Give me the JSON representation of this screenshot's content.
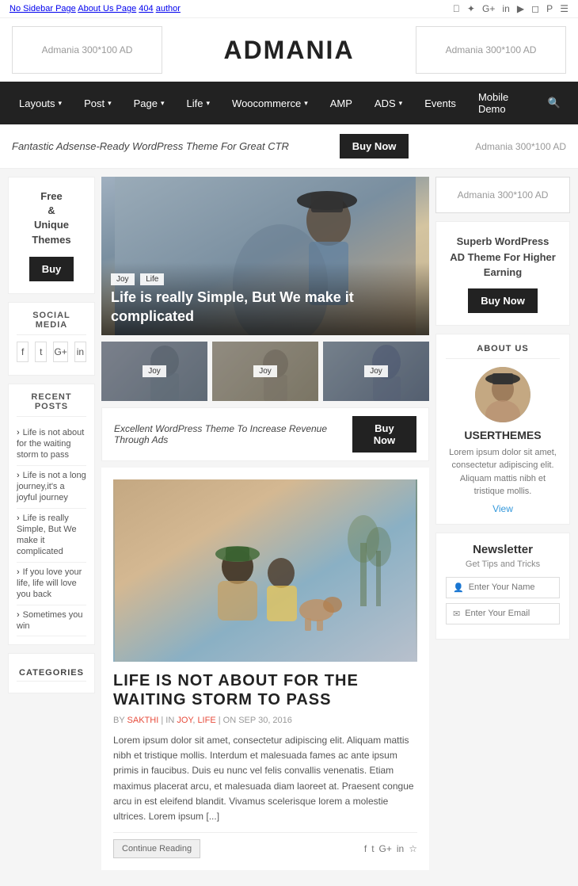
{
  "topbar": {
    "links": [
      "No Sidebar Page",
      "About Us Page",
      "404",
      "author"
    ],
    "social": [
      "f",
      "t",
      "G+",
      "in",
      "yt",
      "ig",
      "p",
      "rss"
    ]
  },
  "header": {
    "ad_left": "Admania 300*100 AD",
    "logo": "ADMANIA",
    "ad_right": "Admania 300*100 AD"
  },
  "nav": {
    "items": [
      {
        "label": "Layouts",
        "has_dropdown": true
      },
      {
        "label": "Post",
        "has_dropdown": true
      },
      {
        "label": "Page",
        "has_dropdown": true
      },
      {
        "label": "Life",
        "has_dropdown": true
      },
      {
        "label": "Woocommerce",
        "has_dropdown": true
      },
      {
        "label": "AMP",
        "has_dropdown": false
      },
      {
        "label": "ADS",
        "has_dropdown": true
      },
      {
        "label": "Events",
        "has_dropdown": false
      },
      {
        "label": "Mobile Demo",
        "has_dropdown": false
      }
    ]
  },
  "top_banner": {
    "text": "Fantastic Adsense-Ready WordPress Theme For Great CTR",
    "button": "Buy Now",
    "ad_text": "Admania 300*100 AD"
  },
  "left_sidebar": {
    "free_themes": {
      "text": "Free\n&\nUnique\nThemes",
      "button": "Buy"
    },
    "social_media_title": "SOCIAL MEDIA",
    "social_icons": [
      "f",
      "t",
      "G+",
      "in"
    ],
    "recent_posts_title": "RECENT POSTS",
    "recent_posts": [
      "Life is not about for the waiting storm to pass",
      "Life is not a long journey,it's a joyful journey",
      "Life is really Simple, But We make it complicated",
      "If you love your life, life will love you back",
      "Sometimes you win"
    ],
    "categories_title": "CATEGORIES"
  },
  "featured_post": {
    "tags": [
      "Joy",
      "Life"
    ],
    "title": "Life is really Simple, But We make it complicated"
  },
  "small_posts": [
    {
      "tag": "Joy"
    },
    {
      "tag": "Joy"
    },
    {
      "tag": "Joy"
    }
  ],
  "content_ad_banner": {
    "text": "Excellent WordPress Theme To Increase Revenue Through Ads",
    "button": "Buy Now"
  },
  "article": {
    "title": "LIFE IS NOT ABOUT FOR THE WAITING STORM TO PASS",
    "meta_by": "BY",
    "meta_author": "SAKTHI",
    "meta_in": "IN",
    "meta_category1": "JOY",
    "meta_category2": "LIFE",
    "meta_on": "ON SEP 30, 2016",
    "body": "Lorem ipsum dolor sit amet, consectetur adipiscing elit. Aliquam mattis nibh et tristique mollis. Interdum et malesuada fames ac ante ipsum primis in faucibus. Duis eu nunc vel felis convallis venenatis. Etiam maximus placerat arcu, et malesuada diam laoreet at. Praesent congue arcu in est eleifend blandit. Vivamus scelerisque lorem a molestie ultrices. Lorem ipsum [...]",
    "continue_reading": "Continue Reading",
    "social_icons": [
      "f",
      "t",
      "G+",
      "in",
      "☆"
    ]
  },
  "right_sidebar": {
    "top_ad": "Admania 300*100 AD",
    "promo": {
      "text": "Superb WordPress AD Theme For Higher Earning",
      "button": "Buy Now",
      "ad_theme_label": "AD Theme",
      "higher_earning_label": "Higher Earning"
    },
    "about_us_title": "ABOUT US",
    "username": "USERTHEMES",
    "about_text": "Lorem ipsum dolor sit amet, consectetur adipiscing elit. Aliquam mattis nibh et tristique mollis.",
    "view_label": "View",
    "newsletter_title": "Newsletter",
    "newsletter_sub": "Get Tips and Tricks",
    "name_placeholder": "Enter Your Name",
    "email_placeholder": "Enter Your Email"
  }
}
